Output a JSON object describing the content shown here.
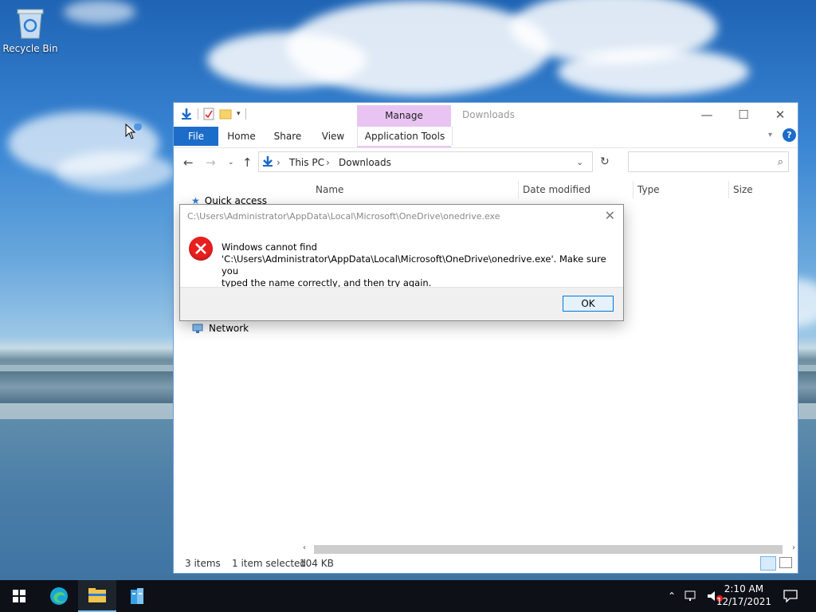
{
  "desktop": {
    "icons": [
      {
        "label": "Recycle Bin",
        "icon": "recycle-bin-icon"
      }
    ]
  },
  "explorer": {
    "title": "Downloads",
    "context_tab_group": "Manage",
    "tabs": [
      "File",
      "Home",
      "Share",
      "View",
      "Application Tools"
    ],
    "breadcrumb": [
      "This PC",
      "Downloads"
    ],
    "search": {
      "placeholder": "",
      "value": ""
    },
    "columns": [
      "Name",
      "Date modified",
      "Type",
      "Size"
    ],
    "nav_items": [
      "Quick access",
      "Network"
    ],
    "status": {
      "items": "3 items",
      "selected": "1 item selected",
      "size": "104 KB"
    },
    "window_controls": {
      "minimize": "—",
      "maximize": "☐",
      "close": "✕"
    }
  },
  "dialog": {
    "title": "C:\\Users\\Administrator\\AppData\\Local\\Microsoft\\OneDrive\\onedrive.exe",
    "message_line1": "Windows cannot find",
    "message_line2": "'C:\\Users\\Administrator\\AppData\\Local\\Microsoft\\OneDrive\\onedrive.exe'. Make sure you",
    "message_line3": "typed the name correctly, and then try again.",
    "ok_label": "OK",
    "close_glyph": "✕"
  },
  "taskbar": {
    "apps": [
      "start-icon",
      "edge-icon",
      "file-explorer-icon",
      "server-manager-icon"
    ],
    "clock_time": "2:10 AM",
    "clock_date": "12/17/2021"
  },
  "colors": {
    "accent": "#1c6dc9",
    "manage_tab": "#e9c4f2",
    "error_red": "#e81f1f",
    "taskbar": "#0d1117"
  }
}
